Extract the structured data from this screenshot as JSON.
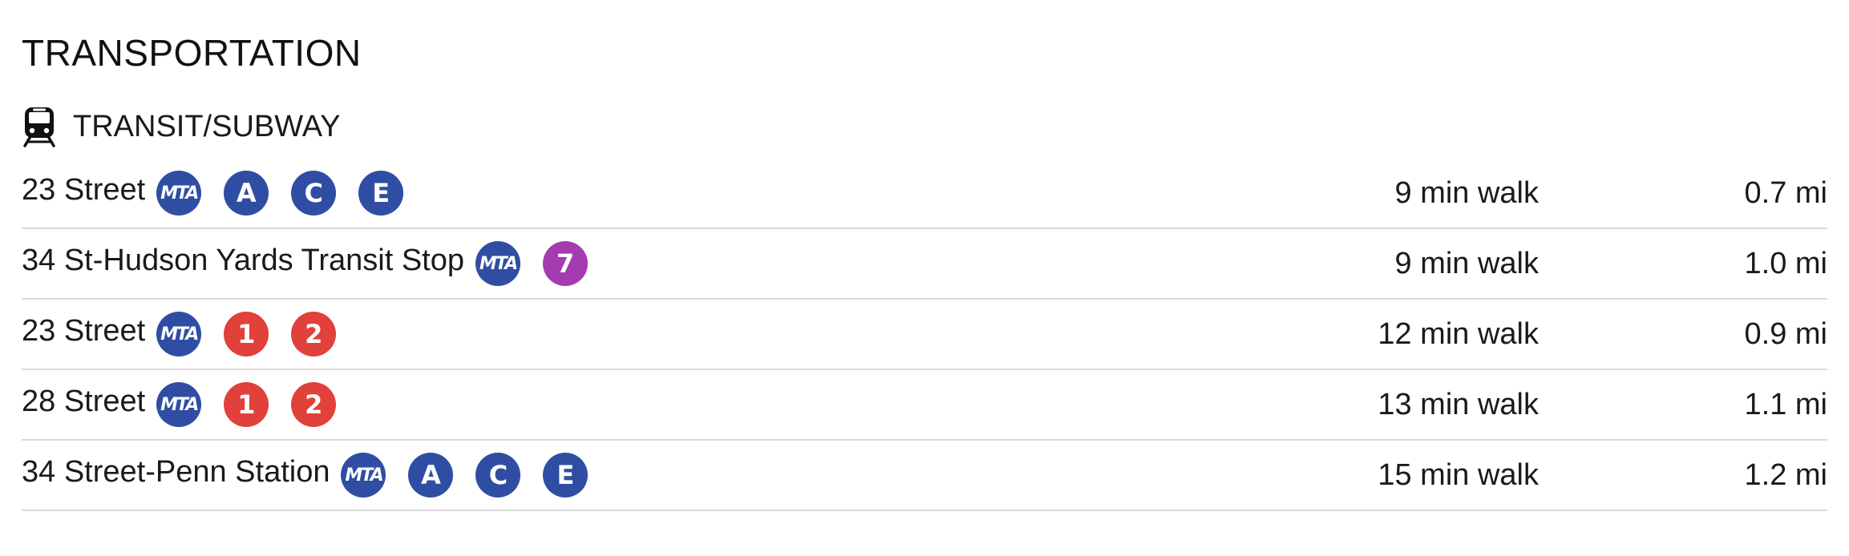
{
  "section": {
    "title": "TRANSPORTATION"
  },
  "category": {
    "icon": "train-icon",
    "label": "TRANSIT/SUBWAY"
  },
  "colors": {
    "mta": "#2f4ea3",
    "ace": "#2f4ea3",
    "seven": "#a53bb0",
    "onetwo": "#e0413a",
    "divider": "#dadada"
  },
  "stations": [
    {
      "name": "23 Street",
      "agency": "MTA",
      "lines": [
        {
          "label": "A",
          "color": "#2f4ea3"
        },
        {
          "label": "C",
          "color": "#2f4ea3"
        },
        {
          "label": "E",
          "color": "#2f4ea3"
        }
      ],
      "walk": "9 min walk",
      "distance": "0.7 mi"
    },
    {
      "name": "34 St-Hudson Yards Transit Stop",
      "agency": "MTA",
      "lines": [
        {
          "label": "7",
          "color": "#a53bb0"
        }
      ],
      "walk": "9 min walk",
      "distance": "1.0 mi"
    },
    {
      "name": "23 Street",
      "agency": "MTA",
      "lines": [
        {
          "label": "1",
          "color": "#e0413a"
        },
        {
          "label": "2",
          "color": "#e0413a"
        }
      ],
      "walk": "12 min walk",
      "distance": "0.9 mi"
    },
    {
      "name": "28 Street",
      "agency": "MTA",
      "lines": [
        {
          "label": "1",
          "color": "#e0413a"
        },
        {
          "label": "2",
          "color": "#e0413a"
        }
      ],
      "walk": "13 min walk",
      "distance": "1.1 mi"
    },
    {
      "name": "34 Street-Penn Station",
      "agency": "MTA",
      "lines": [
        {
          "label": "A",
          "color": "#2f4ea3"
        },
        {
          "label": "C",
          "color": "#2f4ea3"
        },
        {
          "label": "E",
          "color": "#2f4ea3"
        }
      ],
      "walk": "15 min walk",
      "distance": "1.2 mi"
    }
  ]
}
